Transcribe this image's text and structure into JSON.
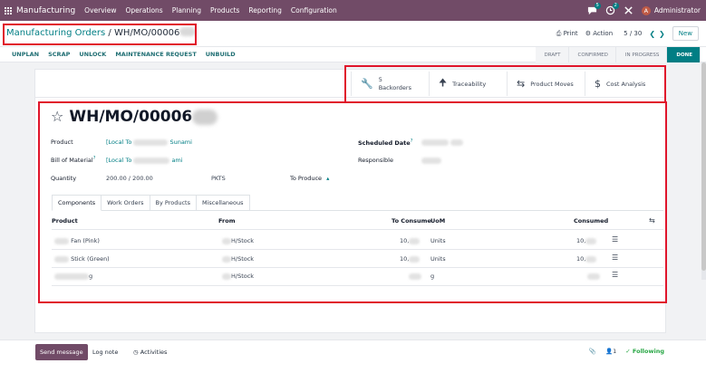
{
  "navbar": {
    "app_name": "Manufacturing",
    "menu": [
      "Overview",
      "Operations",
      "Planning",
      "Products",
      "Reporting",
      "Configuration"
    ],
    "messages_count": "5",
    "activities_count": "2",
    "avatar_letter": "A",
    "user_name": "Administrator"
  },
  "control": {
    "breadcrumb_parent": "Manufacturing Orders",
    "breadcrumb_sep": " / ",
    "breadcrumb_current": "WH/MO/00006",
    "print_label": "Print",
    "action_label": "Action",
    "pager": "5 / 30",
    "new_label": "New"
  },
  "actions": [
    "UNPLAN",
    "SCRAP",
    "UNLOCK",
    "MAINTENANCE REQUEST",
    "UNBUILD"
  ],
  "stages": [
    {
      "label": "DRAFT",
      "active": false
    },
    {
      "label": "CONFIRMED",
      "active": false
    },
    {
      "label": "IN PROGRESS",
      "active": false
    },
    {
      "label": "DONE",
      "active": true
    }
  ],
  "smart_buttons": {
    "backorders_count": "5",
    "backorders_label": "Backorders",
    "traceability": "Traceability",
    "product_moves": "Product Moves",
    "cost_analysis": "Cost Analysis"
  },
  "record": {
    "title": "WH/MO/00006",
    "product_label": "Product",
    "product_value_a": "[Local To",
    "product_value_b": "Sunami",
    "bom_label": "Bill of Material",
    "bom_help": "?",
    "bom_value_a": "[Local To",
    "bom_value_b": "ami",
    "quantity_label": "Quantity",
    "quantity_value": "200.00 / 200.00",
    "uom_value": "PKTS",
    "to_produce_label": "To Produce",
    "scheduled_label": "Scheduled Date",
    "scheduled_help": "?",
    "responsible_label": "Responsible"
  },
  "tabs": [
    {
      "label": "Components",
      "active": true
    },
    {
      "label": "Work Orders",
      "active": false
    },
    {
      "label": "By Products",
      "active": false
    },
    {
      "label": "Miscellaneous",
      "active": false
    }
  ],
  "table": {
    "headers": {
      "product": "Product",
      "from": "From",
      "to_consume": "To Consume",
      "uom": "UoM",
      "consumed": "Consumed"
    },
    "rows": [
      {
        "product": "Fan (Pink)",
        "from": "H/Stock",
        "to_consume": "10,",
        "uom": "Units",
        "consumed": "10,"
      },
      {
        "product": "Stick (Green)",
        "from": "H/Stock",
        "to_consume": "10,",
        "uom": "Units",
        "consumed": "10,"
      },
      {
        "product": "g",
        "from": "H/Stock",
        "to_consume": "",
        "uom": "g",
        "consumed": ""
      }
    ]
  },
  "chatter": {
    "send_message": "Send message",
    "log_note": "Log note",
    "activities": "Activities",
    "followers_count": "1",
    "following": "Following"
  },
  "colors": {
    "brand": "#714b67",
    "accent": "#017e84",
    "highlight_box": "#e0152b"
  }
}
